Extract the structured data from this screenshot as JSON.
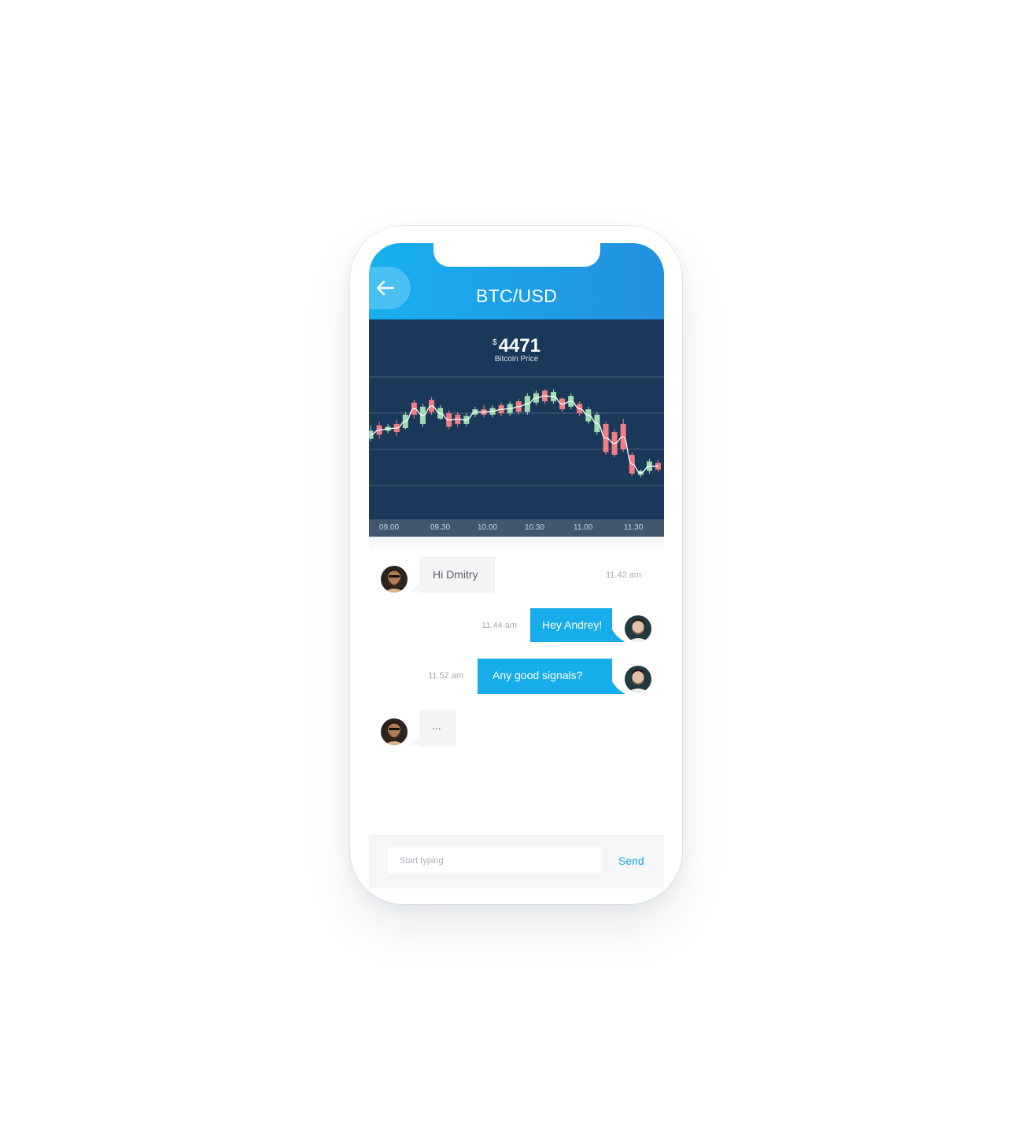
{
  "header": {
    "title": "BTC/USD"
  },
  "chart_data": {
    "type": "candlestick",
    "currency_symbol": "$",
    "price": "4471",
    "price_label": "Bitcoin Price",
    "x_ticks": [
      "09.00",
      "09.30",
      "10.00",
      "10.30",
      "11.00",
      "11.30"
    ],
    "grid": true,
    "colors": {
      "up": "#9fdcb0",
      "down": "#f07f84",
      "line": "#ffffff",
      "background": "#1a3859"
    },
    "candles": [
      {
        "o": 0.52,
        "c": 0.58,
        "h": 0.5,
        "l": 0.62
      },
      {
        "o": 0.62,
        "c": 0.55,
        "h": 0.52,
        "l": 0.65
      },
      {
        "o": 0.58,
        "c": 0.61,
        "h": 0.56,
        "l": 0.63
      },
      {
        "o": 0.63,
        "c": 0.57,
        "h": 0.54,
        "l": 0.66
      },
      {
        "o": 0.6,
        "c": 0.7,
        "h": 0.59,
        "l": 0.72
      },
      {
        "o": 0.79,
        "c": 0.7,
        "h": 0.67,
        "l": 0.81
      },
      {
        "o": 0.63,
        "c": 0.76,
        "h": 0.61,
        "l": 0.78
      },
      {
        "o": 0.81,
        "c": 0.72,
        "h": 0.7,
        "l": 0.83
      },
      {
        "o": 0.67,
        "c": 0.75,
        "h": 0.66,
        "l": 0.77
      },
      {
        "o": 0.71,
        "c": 0.61,
        "h": 0.59,
        "l": 0.73
      },
      {
        "o": 0.7,
        "c": 0.63,
        "h": 0.61,
        "l": 0.72
      },
      {
        "o": 0.63,
        "c": 0.69,
        "h": 0.61,
        "l": 0.71
      },
      {
        "o": 0.7,
        "c": 0.74,
        "h": 0.68,
        "l": 0.76
      },
      {
        "o": 0.74,
        "c": 0.7,
        "h": 0.68,
        "l": 0.77
      },
      {
        "o": 0.7,
        "c": 0.75,
        "h": 0.68,
        "l": 0.77
      },
      {
        "o": 0.77,
        "c": 0.71,
        "h": 0.69,
        "l": 0.79
      },
      {
        "o": 0.71,
        "c": 0.78,
        "h": 0.69,
        "l": 0.8
      },
      {
        "o": 0.8,
        "c": 0.72,
        "h": 0.7,
        "l": 0.82
      },
      {
        "o": 0.72,
        "c": 0.84,
        "h": 0.7,
        "l": 0.86
      },
      {
        "o": 0.79,
        "c": 0.86,
        "h": 0.77,
        "l": 0.88
      },
      {
        "o": 0.88,
        "c": 0.8,
        "h": 0.78,
        "l": 0.89
      },
      {
        "o": 0.8,
        "c": 0.87,
        "h": 0.78,
        "l": 0.89
      },
      {
        "o": 0.82,
        "c": 0.74,
        "h": 0.72,
        "l": 0.83
      },
      {
        "o": 0.76,
        "c": 0.84,
        "h": 0.74,
        "l": 0.86
      },
      {
        "o": 0.78,
        "c": 0.71,
        "h": 0.69,
        "l": 0.8
      },
      {
        "o": 0.65,
        "c": 0.74,
        "h": 0.63,
        "l": 0.76
      },
      {
        "o": 0.57,
        "c": 0.7,
        "h": 0.55,
        "l": 0.72
      },
      {
        "o": 0.63,
        "c": 0.42,
        "h": 0.4,
        "l": 0.65
      },
      {
        "o": 0.57,
        "c": 0.4,
        "h": 0.38,
        "l": 0.59
      },
      {
        "o": 0.63,
        "c": 0.44,
        "h": 0.42,
        "l": 0.67
      },
      {
        "o": 0.4,
        "c": 0.26,
        "h": 0.24,
        "l": 0.42
      },
      {
        "o": 0.25,
        "c": 0.28,
        "h": 0.23,
        "l": 0.29
      },
      {
        "o": 0.28,
        "c": 0.35,
        "h": 0.26,
        "l": 0.37
      },
      {
        "o": 0.34,
        "c": 0.29,
        "h": 0.27,
        "l": 0.36
      }
    ]
  },
  "messages": [
    {
      "side": "in",
      "text": "Hi Dmitry",
      "time": "11.42 am"
    },
    {
      "side": "out",
      "text": "Hey Andrey!",
      "time": "11.44 am"
    },
    {
      "side": "out",
      "text": "Any good signals?",
      "time": "11.52 am"
    },
    {
      "side": "in",
      "text": "...",
      "time": ""
    }
  ],
  "composer": {
    "placeholder": "Start typing",
    "send_label": "Send"
  }
}
